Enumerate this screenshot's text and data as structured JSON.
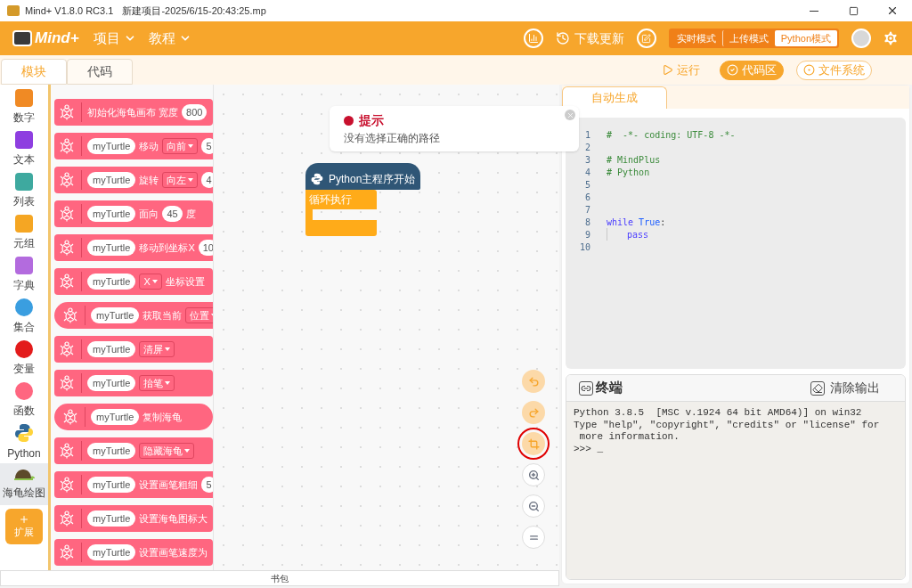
{
  "window": {
    "app": "Mind+ V1.8.0 RC3.1",
    "title": "新建项目-2025/6/15-20:43:25.mp"
  },
  "header": {
    "logo": "Mind+",
    "menus": [
      {
        "label": "项目"
      },
      {
        "label": "教程"
      }
    ],
    "update": "下载更新",
    "modes": [
      {
        "label": "实时模式",
        "selected": false
      },
      {
        "label": "上传模式",
        "selected": false
      },
      {
        "label": "Python模式",
        "selected": true
      }
    ]
  },
  "editor_tabs": [
    {
      "label": "模块",
      "selected": true
    },
    {
      "label": "代码",
      "selected": false
    }
  ],
  "view_buttons": [
    {
      "kind": "run",
      "label": "运行",
      "selected": false
    },
    {
      "kind": "code",
      "label": "代码区",
      "selected": true
    },
    {
      "kind": "files",
      "label": "文件系统",
      "selected": false
    }
  ],
  "categories": [
    {
      "label": "数字",
      "kind": "tile",
      "color": "#f08a24",
      "selected": false
    },
    {
      "label": "文本",
      "kind": "tile",
      "color": "#8e3ee0",
      "selected": false
    },
    {
      "label": "列表",
      "kind": "tile",
      "color": "#3ea99f",
      "selected": false
    },
    {
      "label": "元组",
      "kind": "tile",
      "color": "#f5a623",
      "selected": false
    },
    {
      "label": "字典",
      "kind": "tile",
      "color": "#b36bde",
      "selected": false
    },
    {
      "label": "集合",
      "kind": "circle",
      "color": "#3a9ee0",
      "selected": false
    },
    {
      "label": "变量",
      "kind": "circle",
      "color": "#e31b1b",
      "selected": false
    },
    {
      "label": "函数",
      "kind": "circle",
      "color": "#ff6680",
      "selected": false
    },
    {
      "label": "Python",
      "kind": "python",
      "color": "#306998",
      "selected": false
    },
    {
      "label": "海龟绘图",
      "kind": "turtle",
      "color": "#5d4a2a",
      "selected": true
    }
  ],
  "extension": {
    "label": "扩展"
  },
  "palette_blocks": [
    {
      "kind": "statement",
      "parts": [
        {
          "kind": "text",
          "text": "初始化海龟画布 宽度"
        },
        {
          "kind": "number",
          "text": "800"
        }
      ]
    },
    {
      "kind": "statement",
      "parts": [
        {
          "kind": "pill",
          "text": "myTurtle"
        },
        {
          "kind": "text",
          "text": "移动"
        },
        {
          "kind": "dropdown",
          "text": "向前"
        },
        {
          "kind": "number",
          "text": "5"
        }
      ]
    },
    {
      "kind": "statement",
      "parts": [
        {
          "kind": "pill",
          "text": "myTurtle"
        },
        {
          "kind": "text",
          "text": "旋转"
        },
        {
          "kind": "dropdown",
          "text": "向左"
        },
        {
          "kind": "number",
          "text": "4"
        }
      ]
    },
    {
      "kind": "statement",
      "parts": [
        {
          "kind": "pill",
          "text": "myTurtle"
        },
        {
          "kind": "text",
          "text": "面向"
        },
        {
          "kind": "number",
          "text": "45"
        },
        {
          "kind": "text",
          "text": "度"
        }
      ]
    },
    {
      "kind": "statement",
      "parts": [
        {
          "kind": "pill",
          "text": "myTurtle"
        },
        {
          "kind": "text",
          "text": "移动到坐标X"
        },
        {
          "kind": "number",
          "text": "10"
        }
      ]
    },
    {
      "kind": "statement",
      "parts": [
        {
          "kind": "pill",
          "text": "myTurtle"
        },
        {
          "kind": "dropdown",
          "text": "X"
        },
        {
          "kind": "text",
          "text": "坐标设置"
        }
      ]
    },
    {
      "kind": "reporter",
      "parts": [
        {
          "kind": "pill",
          "text": "myTurtle"
        },
        {
          "kind": "text",
          "text": "获取当前"
        },
        {
          "kind": "dropdown",
          "text": "位置"
        }
      ]
    },
    {
      "kind": "statement",
      "parts": [
        {
          "kind": "pill",
          "text": "myTurtle"
        },
        {
          "kind": "dropdown",
          "text": "清屏"
        }
      ]
    },
    {
      "kind": "statement",
      "parts": [
        {
          "kind": "pill",
          "text": "myTurtle"
        },
        {
          "kind": "dropdown",
          "text": "抬笔"
        }
      ]
    },
    {
      "kind": "reporter",
      "parts": [
        {
          "kind": "pill",
          "text": "myTurtle"
        },
        {
          "kind": "text",
          "text": "复制海龟"
        }
      ]
    },
    {
      "kind": "statement",
      "parts": [
        {
          "kind": "pill",
          "text": "myTurtle"
        },
        {
          "kind": "dropdown",
          "text": "隐藏海龟"
        }
      ]
    },
    {
      "kind": "statement",
      "parts": [
        {
          "kind": "pill",
          "text": "myTurtle"
        },
        {
          "kind": "text",
          "text": "设置画笔粗细"
        },
        {
          "kind": "number",
          "text": "5"
        }
      ]
    },
    {
      "kind": "statement",
      "parts": [
        {
          "kind": "pill",
          "text": "myTurtle"
        },
        {
          "kind": "text",
          "text": "设置海龟图标大"
        }
      ]
    },
    {
      "kind": "statement",
      "parts": [
        {
          "kind": "pill",
          "text": "myTurtle"
        },
        {
          "kind": "text",
          "text": "设置画笔速度为"
        }
      ]
    }
  ],
  "toast": {
    "title": "提示",
    "message": "没有选择正确的路径"
  },
  "canvas_blocks": {
    "hat": "Python主程序开始",
    "loop": "循环执行"
  },
  "canvas_controls": [
    {
      "kind": "undo",
      "highlighted": false
    },
    {
      "kind": "redo",
      "highlighted": false
    },
    {
      "kind": "crop",
      "highlighted": true
    },
    {
      "kind": "zoom-in",
      "highlighted": false
    },
    {
      "kind": "zoom-out",
      "highlighted": false
    },
    {
      "kind": "reset",
      "highlighted": false
    }
  ],
  "backpack": "书包",
  "code_tabs": [
    {
      "label": "自动生成",
      "selected": true
    }
  ],
  "code_lines": [
    {
      "number": "1",
      "indent": false,
      "tokens": [
        {
          "kind": "comment",
          "text": "#  -*- coding: UTF-8 -*-"
        }
      ]
    },
    {
      "number": "2",
      "indent": false
    },
    {
      "number": "3",
      "indent": false,
      "tokens": [
        {
          "kind": "comment",
          "text": "# MindPlus"
        }
      ]
    },
    {
      "number": "4",
      "indent": false,
      "tokens": [
        {
          "kind": "comment",
          "text": "# Python"
        }
      ]
    },
    {
      "number": "5",
      "indent": false
    },
    {
      "number": "6",
      "indent": false
    },
    {
      "number": "7",
      "indent": false
    },
    {
      "number": "8",
      "indent": false,
      "tokens": [
        {
          "kind": "keyword",
          "text": "while"
        },
        {
          "kind": "constant",
          "text": "True"
        },
        {
          "kind": "punct",
          "text": ":"
        }
      ]
    },
    {
      "number": "9",
      "indent": true,
      "tokens": [
        {
          "kind": "keyword",
          "text": "pass"
        }
      ]
    },
    {
      "number": "10",
      "indent": false
    }
  ],
  "terminal": {
    "title": "终端",
    "clear": "清除输出",
    "lines": [
      "Python 3.8.5  [MSC v.1924 64 bit AMD64)] on win32",
      "Type \"help\", \"copyright\", \"credits\" or \"license\" for",
      " more information.",
      ">>> _"
    ]
  }
}
